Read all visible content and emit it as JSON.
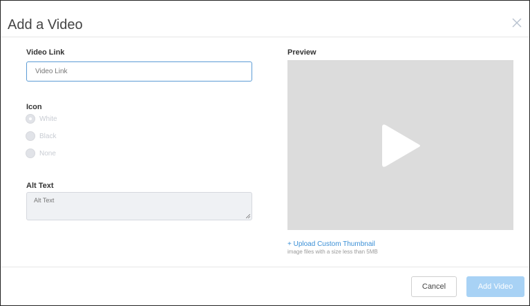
{
  "modal": {
    "title": "Add a Video",
    "close_icon": "close-icon"
  },
  "video_link": {
    "label": "Video Link",
    "placeholder": "Video Link",
    "value": ""
  },
  "icon": {
    "label": "Icon",
    "options": [
      {
        "label": "White",
        "checked": true
      },
      {
        "label": "Black",
        "checked": false
      },
      {
        "label": "None",
        "checked": false
      }
    ]
  },
  "alt_text": {
    "label": "Alt Text",
    "placeholder": "Alt Text",
    "value": ""
  },
  "preview": {
    "label": "Preview",
    "play_icon": "play-icon",
    "upload_link": "+ Upload Custom Thumbnail",
    "upload_hint": "image files with a size less than 5MB"
  },
  "footer": {
    "cancel_label": "Cancel",
    "add_label": "Add Video"
  },
  "colors": {
    "accent": "#5b9bd5",
    "link": "#3a8fd6",
    "add_button_disabled": "#a8d2f5",
    "preview_bg": "#dcdcdc"
  }
}
